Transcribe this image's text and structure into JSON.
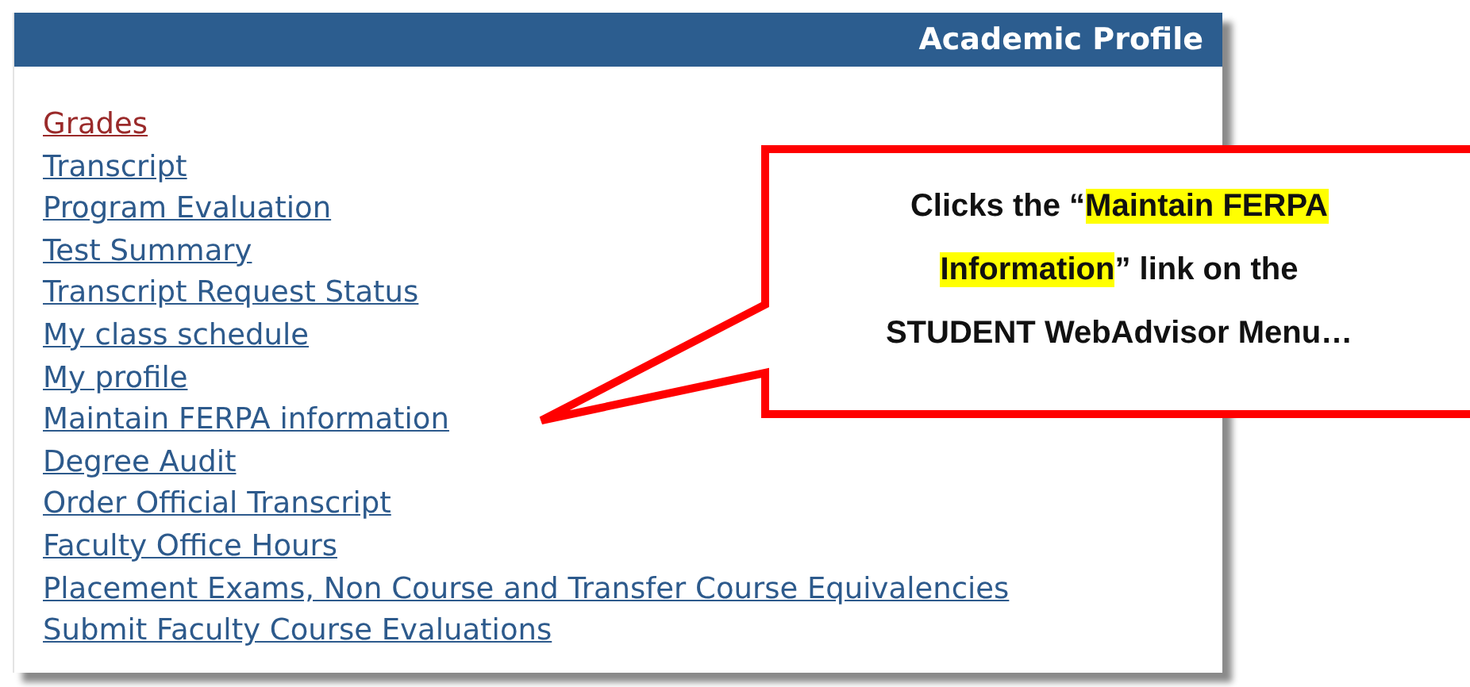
{
  "panel": {
    "title": "Academic Profile",
    "links": [
      {
        "label": "Grades",
        "visited": true
      },
      {
        "label": "Transcript",
        "visited": false
      },
      {
        "label": "Program Evaluation",
        "visited": false
      },
      {
        "label": "Test Summary",
        "visited": false
      },
      {
        "label": "Transcript Request Status",
        "visited": false
      },
      {
        "label": "My class schedule",
        "visited": false
      },
      {
        "label": "My profile",
        "visited": false
      },
      {
        "label": "Maintain FERPA information",
        "visited": false
      },
      {
        "label": "Degree Audit",
        "visited": false
      },
      {
        "label": "Order Official Transcript",
        "visited": false
      },
      {
        "label": "Faculty Office Hours",
        "visited": false
      },
      {
        "label": "Placement Exams, Non Course and Transfer Course Equivalencies",
        "visited": false
      },
      {
        "label": "Submit Faculty Course Evaluations",
        "visited": false
      }
    ]
  },
  "callout": {
    "segments": [
      {
        "text": "Clicks the “",
        "highlighted": false
      },
      {
        "text": "Maintain FERPA\nInformation",
        "highlighted": true
      },
      {
        "text": "” link on the\nSTUDENT WebAdvisor Menu…",
        "highlighted": false
      }
    ]
  }
}
